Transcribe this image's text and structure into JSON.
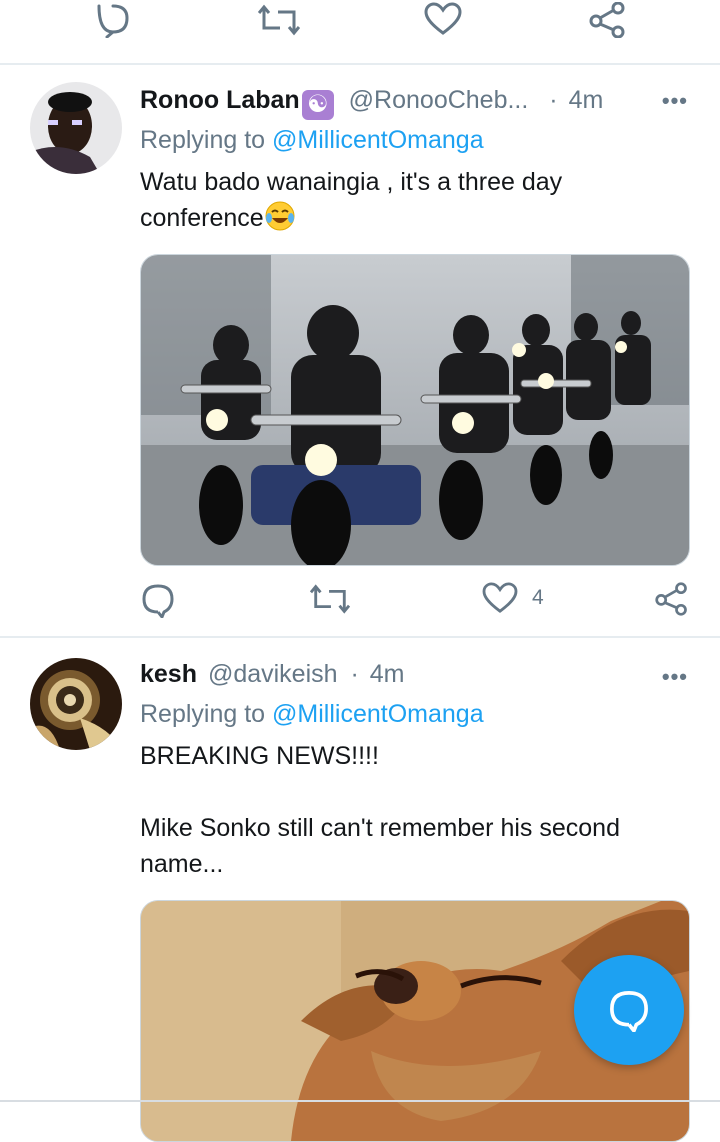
{
  "top_actions": {
    "icons": [
      "reply-icon",
      "retweet-icon",
      "like-icon",
      "share-icon"
    ]
  },
  "tweets": [
    {
      "name": "Ronoo Laban",
      "verified_glyph": "☯",
      "handle": "@RonooCheb...",
      "dot": "·",
      "time": "4m",
      "more": "•••",
      "replying_prefix": "Replying to",
      "replying_to": "@MillicentOmanga",
      "text": "Watu bado wanaingia , it's a three day conference",
      "emoji": "😂",
      "media_alt": "Group of motorcyclists riding in formation",
      "like_count": "4"
    },
    {
      "name": "kesh",
      "handle": "@davikeish",
      "dot": "·",
      "time": "4m",
      "more": "•••",
      "replying_prefix": "Replying to",
      "replying_to": "@MillicentOmanga",
      "text_line1": "BREAKING NEWS!!!!",
      "text_line2": "Mike Sonko still can't remember his second name...",
      "media_alt": "Close-up of a squinting dog"
    }
  ],
  "colors": {
    "accent": "#1da1f2",
    "muted": "#657786",
    "divider": "#e6ecf0"
  },
  "fab": {
    "icon": "compose-reply-icon"
  }
}
